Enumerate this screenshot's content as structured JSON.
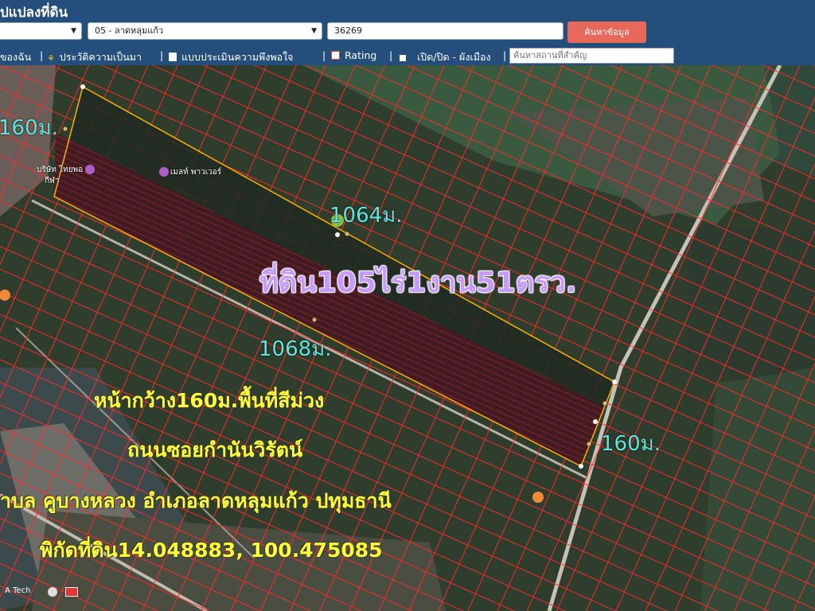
{
  "header": {
    "title": "ปแปลงที่ดิน",
    "select_1": "",
    "select_2": "05 - ลาดหลุมแก้ว",
    "parcel_input": "36269",
    "search_button": "ค้นหาข้อมูล"
  },
  "toolbar": {
    "item_1": "ของฉัน",
    "item_2": "ประวัติความเป็นมา",
    "item_3": "แบบประเมินความพึงพอใจ",
    "item_4": "Rating",
    "item_5": "เปิด/ปิด - ผังเมือง",
    "landmark_placeholder": "ค้นหาสถานที่สำคัญ"
  },
  "map": {
    "measure_left": "160ม.",
    "measure_top": "1064ม.",
    "measure_bottom": "1068ม.",
    "measure_right": "160ม.",
    "area_label": "ที่ดิน105ไร่1งาน51ตรว.",
    "line_1": "หน้ากว้าง160ม.พื้นที่สีม่วง",
    "line_2": "ถนนซอยกำนันวิรัตน์",
    "line_3": "าบล คูบางหลวง อำเภอลาดหลุมแก้ว ปทุมธานี",
    "line_4": "พิกัดที่ดิน14.048883, 100.475085",
    "poi_1": "บริษัท ไทยพอ",
    "poi_2": "เมลท์ พาวเวอร์",
    "poi_3": "กีฬา",
    "attribution": "A Tech"
  },
  "colors": {
    "header_bg": "#244e7c",
    "search_button_bg": "#e8695a",
    "parcel_line": "#ff2a2a",
    "boundary": "#ffb000",
    "highlight_fill": "#4a1620",
    "measure_text": "#5fe6e0",
    "area_text": "#c59bff",
    "info_text": "#ffff33"
  }
}
